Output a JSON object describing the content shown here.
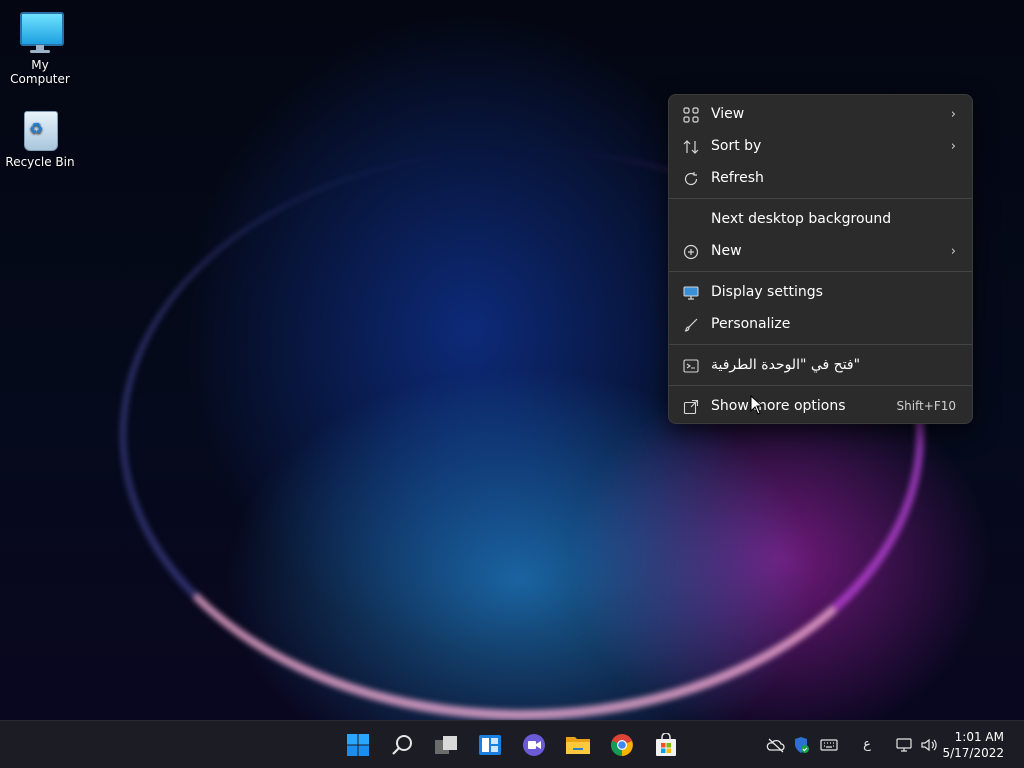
{
  "desktop": {
    "icons": [
      {
        "label": "My Computer",
        "icon": "computer-icon"
      },
      {
        "label": "Recycle Bin",
        "icon": "recycle-bin-icon"
      }
    ]
  },
  "context_menu": {
    "items": [
      {
        "label": "View",
        "icon": "grid-icon",
        "submenu": true
      },
      {
        "label": "Sort by",
        "icon": "sort-icon",
        "submenu": true
      },
      {
        "label": "Refresh",
        "icon": "refresh-icon",
        "submenu": false
      },
      {
        "label": "Next desktop background",
        "icon": "",
        "submenu": false
      },
      {
        "label": "New",
        "icon": "plus-circle-icon",
        "submenu": true
      },
      {
        "label": "Display settings",
        "icon": "display-icon",
        "submenu": false
      },
      {
        "label": "Personalize",
        "icon": "brush-icon",
        "submenu": false
      },
      {
        "label": "فتح في \"الوحدة الطرفية\"",
        "icon": "terminal-icon",
        "submenu": false
      },
      {
        "label": "Show more options",
        "icon": "more-options-icon",
        "shortcut": "Shift+F10"
      }
    ]
  },
  "taskbar": {
    "apps": [
      "start-icon",
      "search-icon",
      "task-view-icon",
      "widgets-icon",
      "chat-icon",
      "file-explorer-icon",
      "chrome-icon",
      "store-icon"
    ],
    "tray": {
      "language": "ع",
      "time": "1:01 AM",
      "date": "5/17/2022"
    }
  },
  "colors": {
    "menu_bg": "#2b2b2b",
    "taskbar_bg": "#1c1c24",
    "accent": "#0a84ff"
  }
}
